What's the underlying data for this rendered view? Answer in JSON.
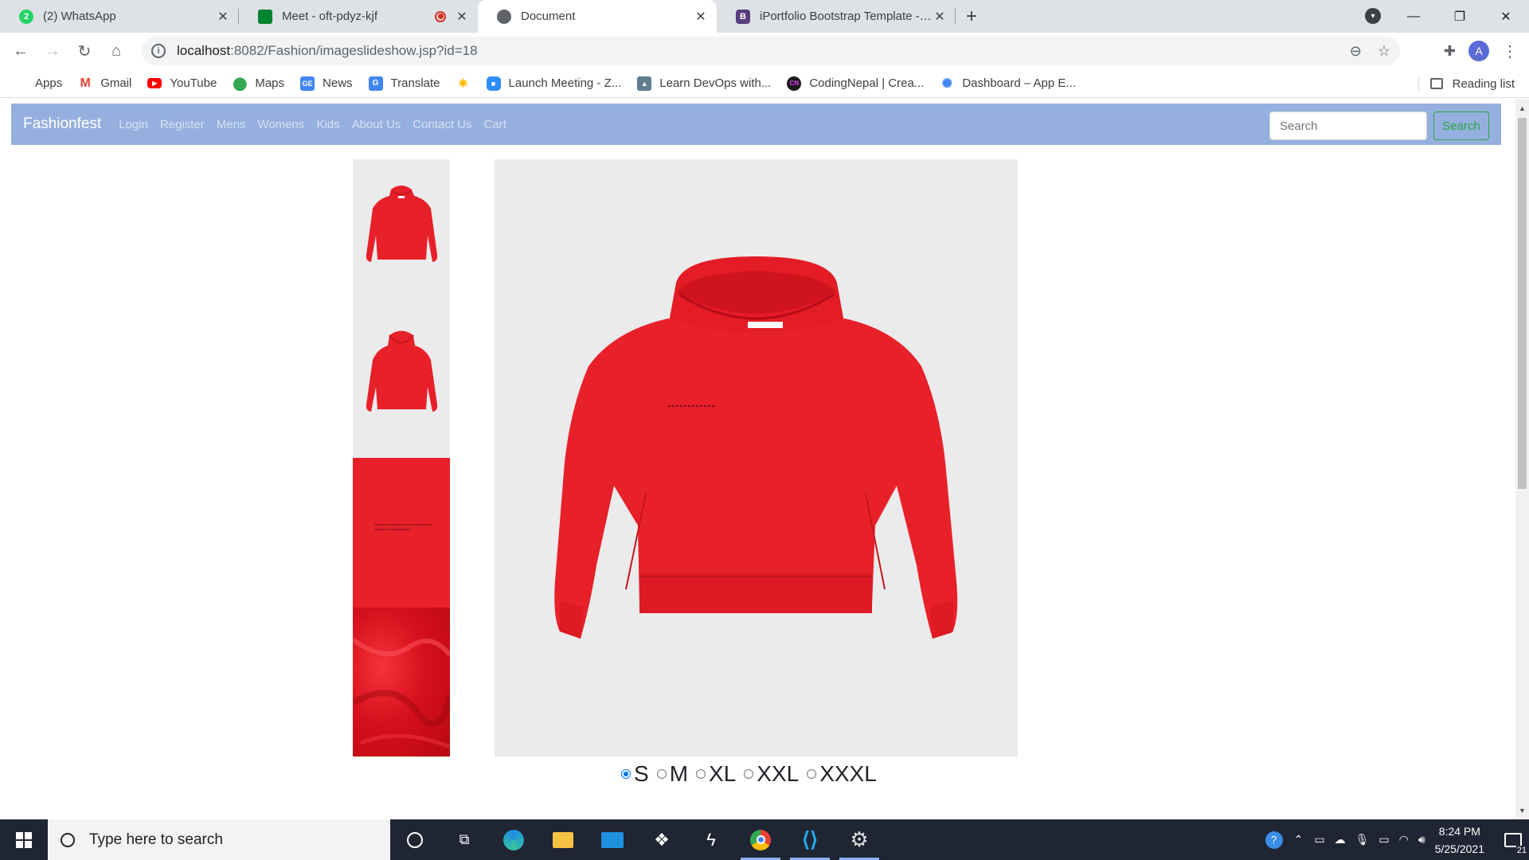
{
  "browser": {
    "tabs": [
      {
        "title": "(2) WhatsApp",
        "favicon_color": "#25d366",
        "favicon_text": "2"
      },
      {
        "title": "Meet - oft-pdyz-kjf",
        "favicon_color": "#00832d",
        "favicon_text": ""
      },
      {
        "title": "Document",
        "favicon_color": "#5f6368",
        "favicon_text": ""
      },
      {
        "title": "iPortfolio Bootstrap Template - In",
        "favicon_color": "#563d7c",
        "favicon_text": "B"
      }
    ],
    "active_tab_index": 2,
    "url_host": "localhost",
    "url_path": ":8082/Fashion/imageslideshow.jsp?id=18",
    "profile_initial": "A"
  },
  "bookmarks": [
    {
      "label": "Apps",
      "icon": "apps-grid-icon",
      "color": "#ea4335"
    },
    {
      "label": "Gmail",
      "icon": "gmail-icon",
      "color": "#ea4335"
    },
    {
      "label": "YouTube",
      "icon": "youtube-icon",
      "color": "#ff0000"
    },
    {
      "label": "Maps",
      "icon": "maps-icon",
      "color": "#34a853"
    },
    {
      "label": "News",
      "icon": "news-icon",
      "color": "#4285f4"
    },
    {
      "label": "Translate",
      "icon": "translate-icon",
      "color": "#4285f4"
    },
    {
      "label": "",
      "icon": "star-burst-icon",
      "color": "#fbbc04"
    },
    {
      "label": "Launch Meeting - Z...",
      "icon": "zoom-icon",
      "color": "#2d8cff"
    },
    {
      "label": "Learn DevOps with...",
      "icon": "devops-icon",
      "color": "#607d8b"
    },
    {
      "label": "CodingNepal | Crea...",
      "icon": "codingnepal-icon",
      "color": "#6a1b9a"
    },
    {
      "label": "Dashboard – App E...",
      "icon": "dashboard-icon",
      "color": "#4285f4"
    }
  ],
  "reading_list_label": "Reading list",
  "site": {
    "brand": "Fashionfest",
    "nav_links": [
      "Login",
      "Register",
      "Mens",
      "Womens",
      "Kids",
      "About Us",
      "Contact Us",
      "Cart"
    ],
    "search_placeholder": "Search",
    "search_button": "Search",
    "colors": {
      "navbar": "#95b0de",
      "search_btn": "#28a745",
      "product": "#e8202a"
    }
  },
  "product": {
    "thumbnails": [
      "hoodie-front",
      "hoodie-back",
      "fabric-print-detail",
      "fabric-closeup"
    ],
    "sizes": [
      "S",
      "M",
      "XL",
      "XXL",
      "XXXL"
    ],
    "selected_size": "S"
  },
  "taskbar": {
    "search_placeholder": "Type here to search",
    "time": "8:24 PM",
    "date": "5/25/2021",
    "notifications": "21"
  }
}
